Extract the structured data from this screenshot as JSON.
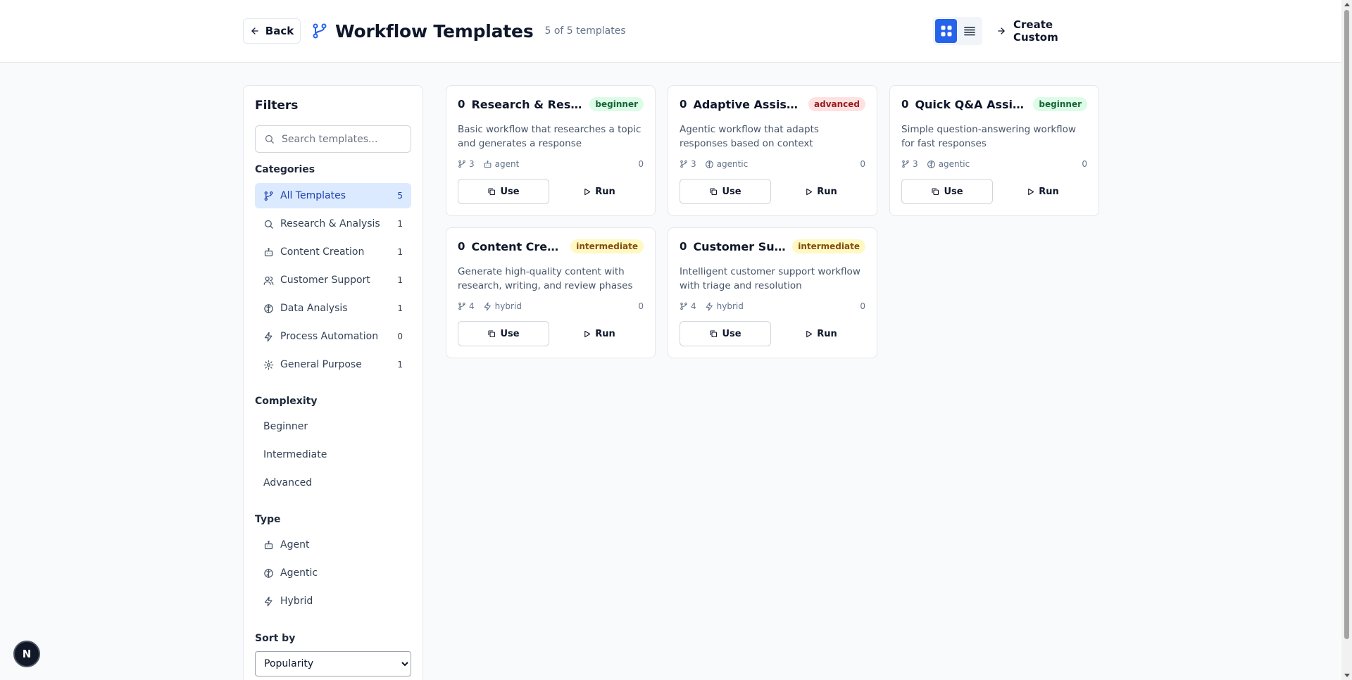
{
  "header": {
    "back_label": "Back",
    "title": "Workflow Templates",
    "count_text": "5 of 5 templates",
    "create_label": "Create Custom",
    "accent_color": "#2563eb"
  },
  "sidebar": {
    "title": "Filters",
    "search_placeholder": "Search templates...",
    "categories_label": "Categories",
    "categories": [
      {
        "label": "All Templates",
        "count": "5",
        "icon": "workflow-icon",
        "active": true
      },
      {
        "label": "Research & Analysis",
        "count": "1",
        "icon": "search-icon"
      },
      {
        "label": "Content Creation",
        "count": "1",
        "icon": "bot-icon"
      },
      {
        "label": "Customer Support",
        "count": "1",
        "icon": "users-icon"
      },
      {
        "label": "Data Analysis",
        "count": "1",
        "icon": "brain-icon"
      },
      {
        "label": "Process Automation",
        "count": "0",
        "icon": "zap-icon"
      },
      {
        "label": "General Purpose",
        "count": "1",
        "icon": "gear-icon"
      }
    ],
    "complexity_label": "Complexity",
    "complexity": [
      "Beginner",
      "Intermediate",
      "Advanced"
    ],
    "type_label": "Type",
    "types": [
      {
        "label": "Agent",
        "icon": "bot-icon"
      },
      {
        "label": "Agentic",
        "icon": "brain-icon"
      },
      {
        "label": "Hybrid",
        "icon": "zap-icon"
      }
    ],
    "sort_label": "Sort by",
    "sort_value": "Popularity"
  },
  "cards": [
    {
      "num": "0",
      "name": "Research & Respond",
      "badge": "beginner",
      "desc": "Basic workflow that researches a topic and generates a response",
      "steps": "3",
      "type": "agent",
      "type_icon": "bot-icon",
      "uses": "0",
      "use_label": "Use",
      "run_label": "Run"
    },
    {
      "num": "0",
      "name": "Adaptive Assistant",
      "badge": "advanced",
      "desc": "Agentic workflow that adapts responses based on context",
      "steps": "3",
      "type": "agentic",
      "type_icon": "brain-icon",
      "uses": "0",
      "use_label": "Use",
      "run_label": "Run"
    },
    {
      "num": "0",
      "name": "Quick Q&A Assistant",
      "badge": "beginner",
      "desc": "Simple question-answering workflow for fast responses",
      "steps": "3",
      "type": "agentic",
      "type_icon": "brain-icon",
      "uses": "0",
      "use_label": "Use",
      "run_label": "Run"
    },
    {
      "num": "0",
      "name": "Content Creation...",
      "badge": "intermediate",
      "desc": "Generate high-quality content with research, writing, and review phases",
      "steps": "4",
      "type": "hybrid",
      "type_icon": "zap-icon",
      "uses": "0",
      "use_label": "Use",
      "run_label": "Run"
    },
    {
      "num": "0",
      "name": "Customer Support...",
      "badge": "intermediate",
      "desc": "Intelligent customer support workflow with triage and resolution",
      "steps": "4",
      "type": "hybrid",
      "type_icon": "zap-icon",
      "uses": "0",
      "use_label": "Use",
      "run_label": "Run"
    }
  ],
  "devtools_badge": "N"
}
